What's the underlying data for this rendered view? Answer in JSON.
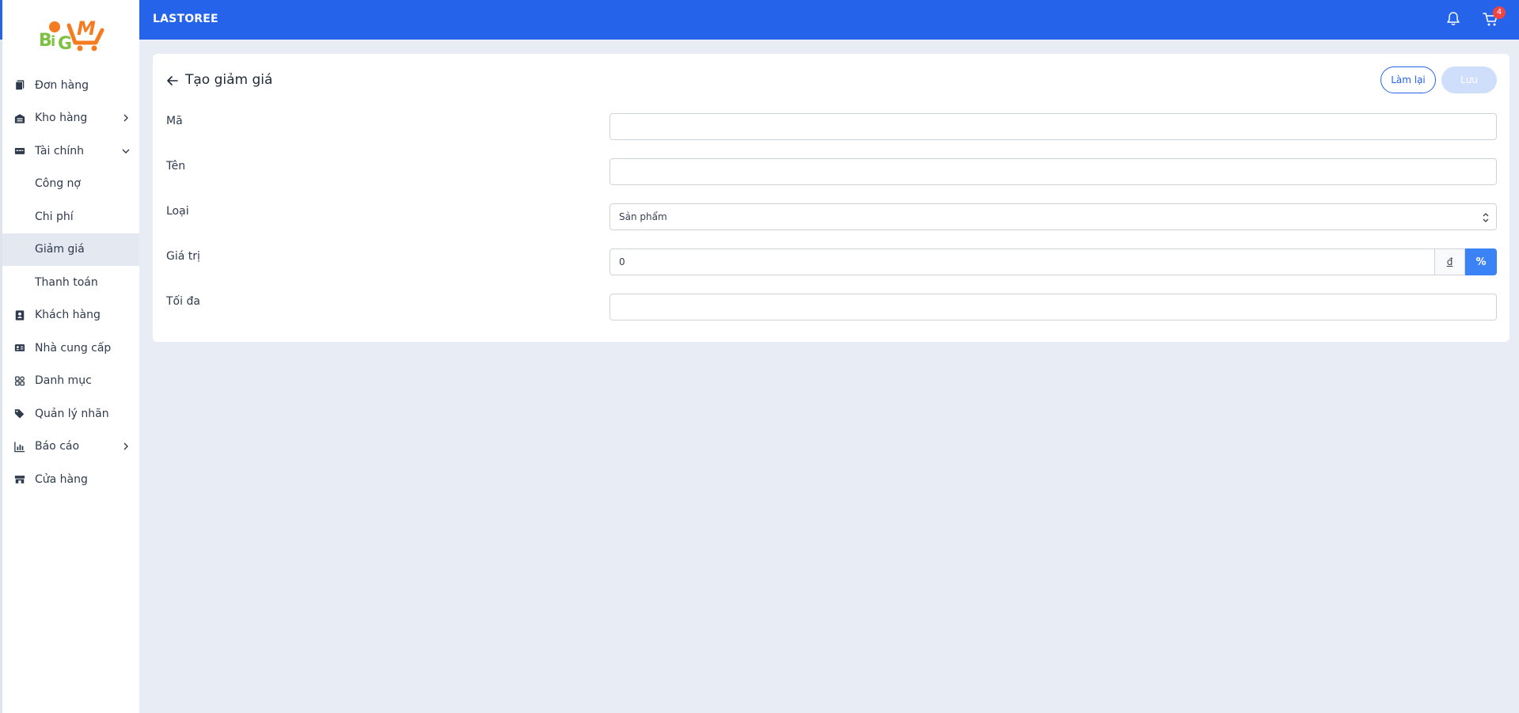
{
  "header": {
    "app_title": "LASTOREE",
    "cart_count": "4"
  },
  "sidebar": {
    "logo_text": "BIG M",
    "items": [
      {
        "label": "Đơn hàng",
        "icon": "orders-icon"
      },
      {
        "label": "Kho hàng",
        "icon": "warehouse-icon",
        "chevron": "right"
      },
      {
        "label": "Tài chính",
        "icon": "finance-icon",
        "chevron": "down"
      },
      {
        "label": "Công nợ",
        "sub": true
      },
      {
        "label": "Chi phí",
        "sub": true
      },
      {
        "label": "Giảm giá",
        "sub": true,
        "active": true
      },
      {
        "label": "Thanh toán",
        "sub": true
      },
      {
        "label": "Khách hàng",
        "icon": "customer-icon"
      },
      {
        "label": "Nhà cung cấp",
        "icon": "supplier-icon"
      },
      {
        "label": "Danh mục",
        "icon": "category-icon"
      },
      {
        "label": "Quản lý nhãn",
        "icon": "tags-icon"
      },
      {
        "label": "Báo cáo",
        "icon": "report-icon",
        "chevron": "right"
      },
      {
        "label": "Cửa hàng",
        "icon": "store-icon"
      }
    ]
  },
  "page": {
    "title": "Tạo giảm giá",
    "reset_label": "Làm lại",
    "save_label": "Lưu"
  },
  "form": {
    "code": {
      "label": "Mã",
      "value": ""
    },
    "name": {
      "label": "Tên",
      "value": ""
    },
    "type": {
      "label": "Loại",
      "selected": "Sản phẩm"
    },
    "value": {
      "label": "Giá trị",
      "value": "0",
      "unit_vnd": "đ",
      "unit_percent": "%"
    },
    "max": {
      "label": "Tối đa",
      "value": ""
    }
  },
  "colors": {
    "primary": "#2563eb",
    "accent": "#3b82f6",
    "badge": "#ef4444",
    "active_bg": "#e3e8f1",
    "page_bg": "#e8ecf4"
  }
}
